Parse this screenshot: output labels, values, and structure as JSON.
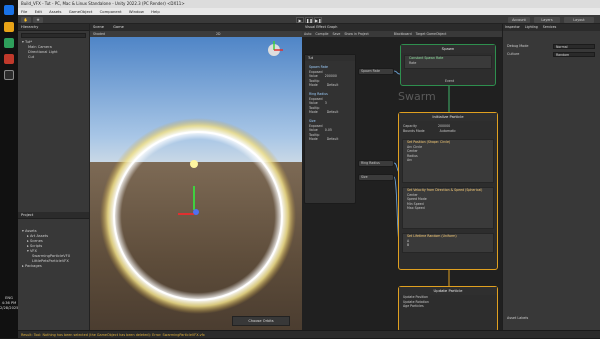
{
  "window": {
    "title": "Build_VFX - Tut - PC, Mac & Linux Standalone - Unity 2022.3 (PC Render) <DX11>"
  },
  "menu": [
    "File",
    "Edit",
    "Assets",
    "GameObject",
    "Component",
    "Window",
    "Help"
  ],
  "toolbar": {
    "account_label": "Account",
    "layers_label": "Layers",
    "layout_label": "Layout"
  },
  "hierarchy": {
    "tab": "Hierarchy",
    "items": [
      "Tut*",
      "Main Camera",
      "Directional Light",
      "Cut"
    ]
  },
  "project": {
    "tab": "Project",
    "items": [
      "Assets",
      "Art Assets",
      "Scenes",
      "Scripts",
      "VFX",
      "SwarmingParticleVFX",
      "LittlePetsParticleVFX",
      "Packages"
    ]
  },
  "scene": {
    "tabs": [
      "Scene",
      "Game"
    ],
    "shading": "Shaded",
    "mode_2d": "2D",
    "camera_button": "Choose Orbits"
  },
  "vfx": {
    "tabs": [
      "Visual Effect Graph",
      "Tut"
    ],
    "toolbar": [
      "Auto",
      "Compile",
      "Save",
      "Show in Project",
      "Blackboard",
      "Target GameObject",
      "Attachment"
    ],
    "blackboard": {
      "title": "Tut",
      "properties": [
        {
          "name": "Spawn Rate",
          "rows": [
            "Exposed",
            "Value",
            "Tooltip",
            "Mode"
          ],
          "value": "200000",
          "mode": "Default"
        },
        {
          "name": "Ring Radius",
          "rows": [
            "Exposed",
            "Value",
            "Tooltip",
            "Mode"
          ],
          "value": "3",
          "mode": "Default"
        },
        {
          "name": "Size",
          "rows": [
            "Exposed",
            "Value",
            "Tooltip",
            "Mode"
          ],
          "value": "0.05",
          "mode": "Default"
        }
      ]
    },
    "param_spawn": "Spawn Rate",
    "param_ring": "Ring Radius",
    "param_size": "Size",
    "spawn_ctx": {
      "title": "Spawn",
      "block": "Constant Spawn Rate",
      "rate_label": "Rate",
      "footer": "Event"
    },
    "system_title": "Swarm",
    "init_ctx": {
      "title": "Initialize Particle",
      "rows": [
        "Capacity",
        "Bounds Mode"
      ],
      "capacity": "200000",
      "bounds": "Automatic",
      "block1": "Set Position (Shape: Circle)",
      "block1_rows": [
        "Arc Circle",
        "Center",
        "Radius",
        "Arc"
      ],
      "block2": "Set Velocity from Direction & Speed (Spherical)",
      "block2_rows": [
        "Center",
        "Speed Mode",
        "Min Speed",
        "Max Speed"
      ],
      "block3": "Set Lifetime Random (Uniform)",
      "block3_rows": [
        "A",
        "B"
      ]
    },
    "update_ctx": {
      "title": "Update Particle",
      "rows": [
        "Update Position",
        "Update Rotation",
        "Age Particles",
        "Reap Particles"
      ]
    }
  },
  "inspector": {
    "tabs": [
      "Inspector",
      "Lighting",
      "Services"
    ],
    "label_mode": "Debug Mode",
    "value_mode": "Normal",
    "row1_label": "Culture",
    "row1_value": "Random",
    "footer": "Asset Labels"
  },
  "status": {
    "message": "Result: Tool: Nothing has been selected (the GameObject has been deleted): Error: SwarmingParticleVFX.vfx"
  },
  "os": {
    "time": "4:36 PM",
    "date": "2/28/2025",
    "lang": "ENG"
  }
}
